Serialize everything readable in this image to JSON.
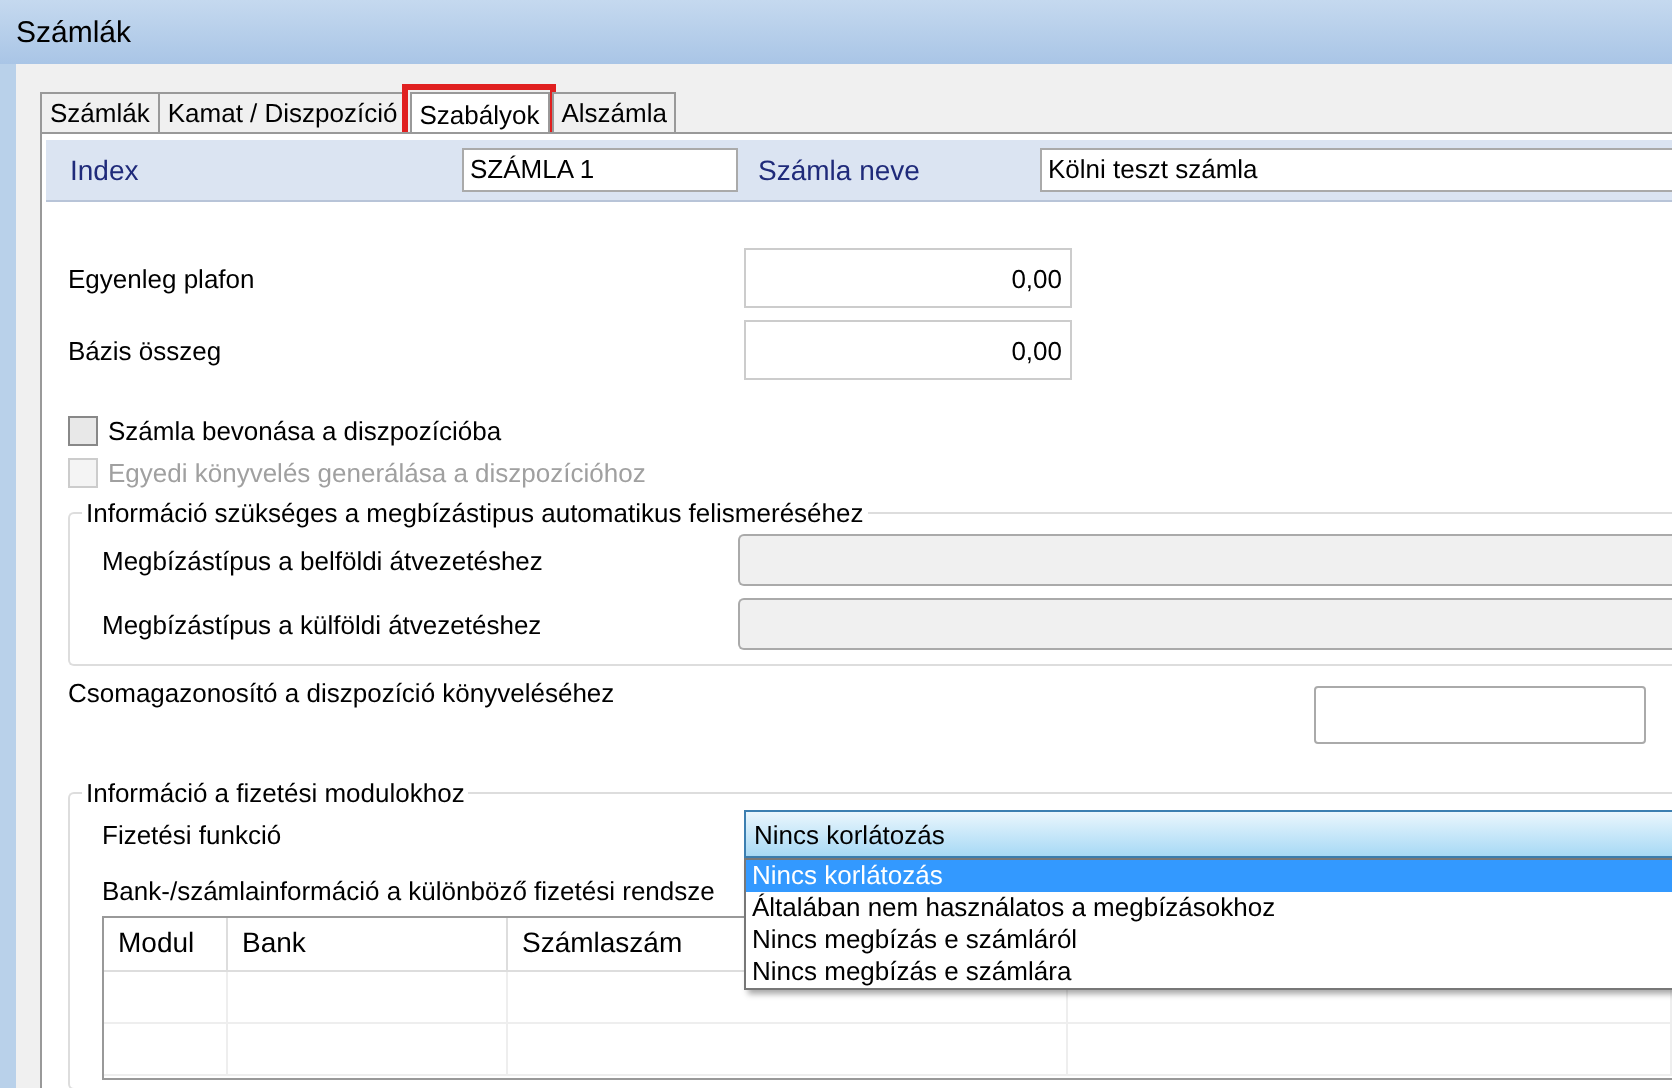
{
  "window": {
    "title": "Számlák"
  },
  "tabs": [
    {
      "label": "Számlák",
      "selected": false,
      "highlighted": false
    },
    {
      "label": "Kamat / Diszpozíció",
      "selected": false,
      "highlighted": false
    },
    {
      "label": "Szabályok",
      "selected": true,
      "highlighted": true
    },
    {
      "label": "Alszámla",
      "selected": false,
      "highlighted": false
    }
  ],
  "header": {
    "index_label": "Index",
    "index_value": "SZÁMLA 1",
    "name_label": "Számla neve",
    "name_value": "Kölni teszt számla"
  },
  "amounts": [
    {
      "label": "Egyenleg plafon",
      "value": "0,00"
    },
    {
      "label": "Bázis összeg",
      "value": "0,00"
    }
  ],
  "checkboxes": [
    {
      "label": "Számla bevonása a diszpozícióba",
      "checked": false,
      "disabled": false
    },
    {
      "label": "Egyedi könyvelés generálása a diszpozícióhoz",
      "checked": false,
      "disabled": true
    }
  ],
  "recognition_group": {
    "title": "Információ szükséges a megbízástipus automatikus felismeréséhez",
    "rows": [
      {
        "label": "Megbízástípus a belföldi átvezetéshez",
        "disabled": true
      },
      {
        "label": "Megbízástípus a külföldi átvezetéshez",
        "disabled": true
      }
    ]
  },
  "package_id": {
    "label": "Csomagazonosító a diszpozíció könyveléséhez"
  },
  "payment_group": {
    "title": "Információ a fizetési modulokhoz",
    "function_label": "Fizetési funkció",
    "function_value": "Nincs korlátozás",
    "expanded": true,
    "options": [
      {
        "label": "Nincs korlátozás",
        "selected": true
      },
      {
        "label": "Általában nem használatos a megbízásokhoz",
        "selected": false
      },
      {
        "label": "Nincs megbízás e számláról",
        "selected": false
      },
      {
        "label": "Nincs megbízás e számlára",
        "selected": false
      }
    ],
    "table_label": "Bank-/számlainformáció a különböző fizetési rendsze",
    "table": {
      "columns": [
        "Modul",
        "Bank",
        "Számlaszám"
      ]
    }
  }
}
